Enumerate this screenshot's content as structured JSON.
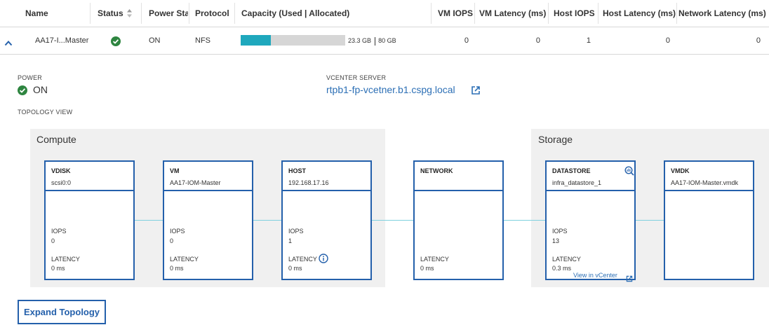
{
  "table": {
    "columns": [
      "Name",
      "Status",
      "Power Status",
      "Protocol",
      "Capacity (Used | Allocated)",
      "VM IOPS",
      "VM Latency (ms)",
      "Host IOPS",
      "Host Latency (ms)",
      "Network Latency (ms)"
    ],
    "row": {
      "name": "AA17-I...Master",
      "power": "ON",
      "protocol": "NFS",
      "capacity_used_text": "23.3 GB",
      "capacity_alloc_text": "80 GB",
      "capacity_fraction": 0.29,
      "vm_iops": "0",
      "vm_latency": "0",
      "host_iops": "1",
      "host_latency": "0",
      "network_latency": "0"
    }
  },
  "details": {
    "power_label": "POWER",
    "power_value": "ON",
    "vcenter_label": "VCENTER SERVER",
    "vcenter_value": "rtpb1-fp-vcetner.b1.cspg.local",
    "topology_label": "TOPOLOGY VIEW"
  },
  "topology": {
    "compute_title": "Compute",
    "storage_title": "Storage",
    "cards": [
      {
        "title": "VDISK",
        "sub": "scsi0:0",
        "iops_label": "IOPS",
        "iops": "0",
        "latency_label": "LATENCY",
        "latency": "0 ms"
      },
      {
        "title": "VM",
        "sub": "AA17-IOM-Master",
        "iops_label": "IOPS",
        "iops": "0",
        "latency_label": "LATENCY",
        "latency": "0 ms"
      },
      {
        "title": "HOST",
        "sub": "192.168.17.16",
        "iops_label": "IOPS",
        "iops": "1",
        "latency_label": "LATENCY",
        "latency": "0 ms"
      },
      {
        "title": "NETWORK",
        "latency_label": "LATENCY",
        "latency": "0 ms"
      },
      {
        "title": "DATASTORE",
        "sub": "infra_datastore_1",
        "iops_label": "IOPS",
        "iops": "13",
        "latency_label": "LATENCY",
        "latency": "0.3 ms",
        "link": "View in vCenter"
      },
      {
        "title": "VMDK",
        "sub": "AA17-IOM-Master.vmdk"
      }
    ]
  },
  "expand_button": "Expand Topology",
  "colors": {
    "accent": "#2460ab",
    "link": "#2c6fb5",
    "capacity": "#1fa8bd",
    "status_ok": "#2e8540",
    "connector": "#7fd1de"
  }
}
